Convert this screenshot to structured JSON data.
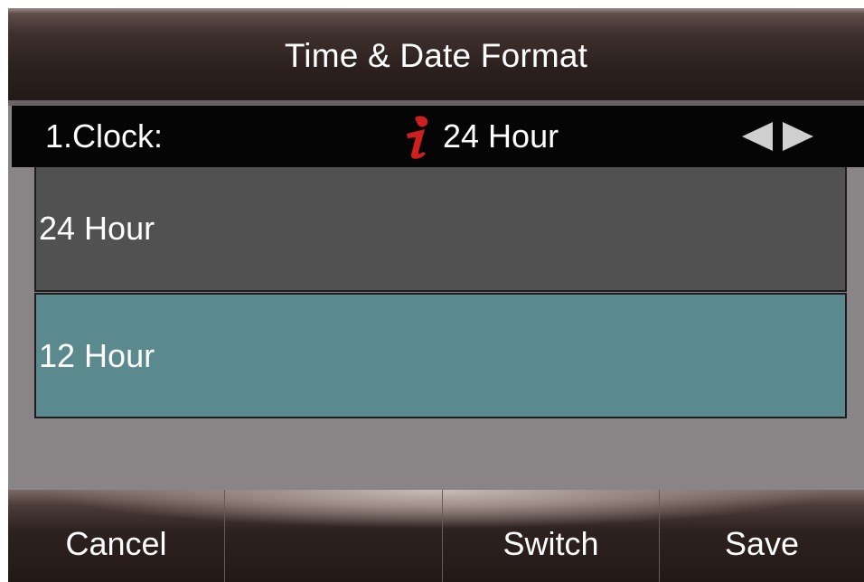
{
  "title": "Time & Date Format",
  "field": {
    "label": "1.Clock:",
    "value": "24 Hour",
    "icon": "info-icon",
    "arrow_left_icon": "arrow-left-icon",
    "arrow_right_icon": "arrow-right-icon"
  },
  "options": [
    {
      "label": "24 Hour",
      "selected": false
    },
    {
      "label": "12 Hour",
      "selected": true
    }
  ],
  "softkeys": [
    {
      "label": "Cancel"
    },
    {
      "label": ""
    },
    {
      "label": "Switch"
    },
    {
      "label": "Save"
    }
  ],
  "colors": {
    "background": "#898587",
    "option_normal": "#515152",
    "option_selected": "#5b8a8e",
    "field_row": "#050505",
    "info_icon": "#d01f1f",
    "text": "#ffffff"
  }
}
